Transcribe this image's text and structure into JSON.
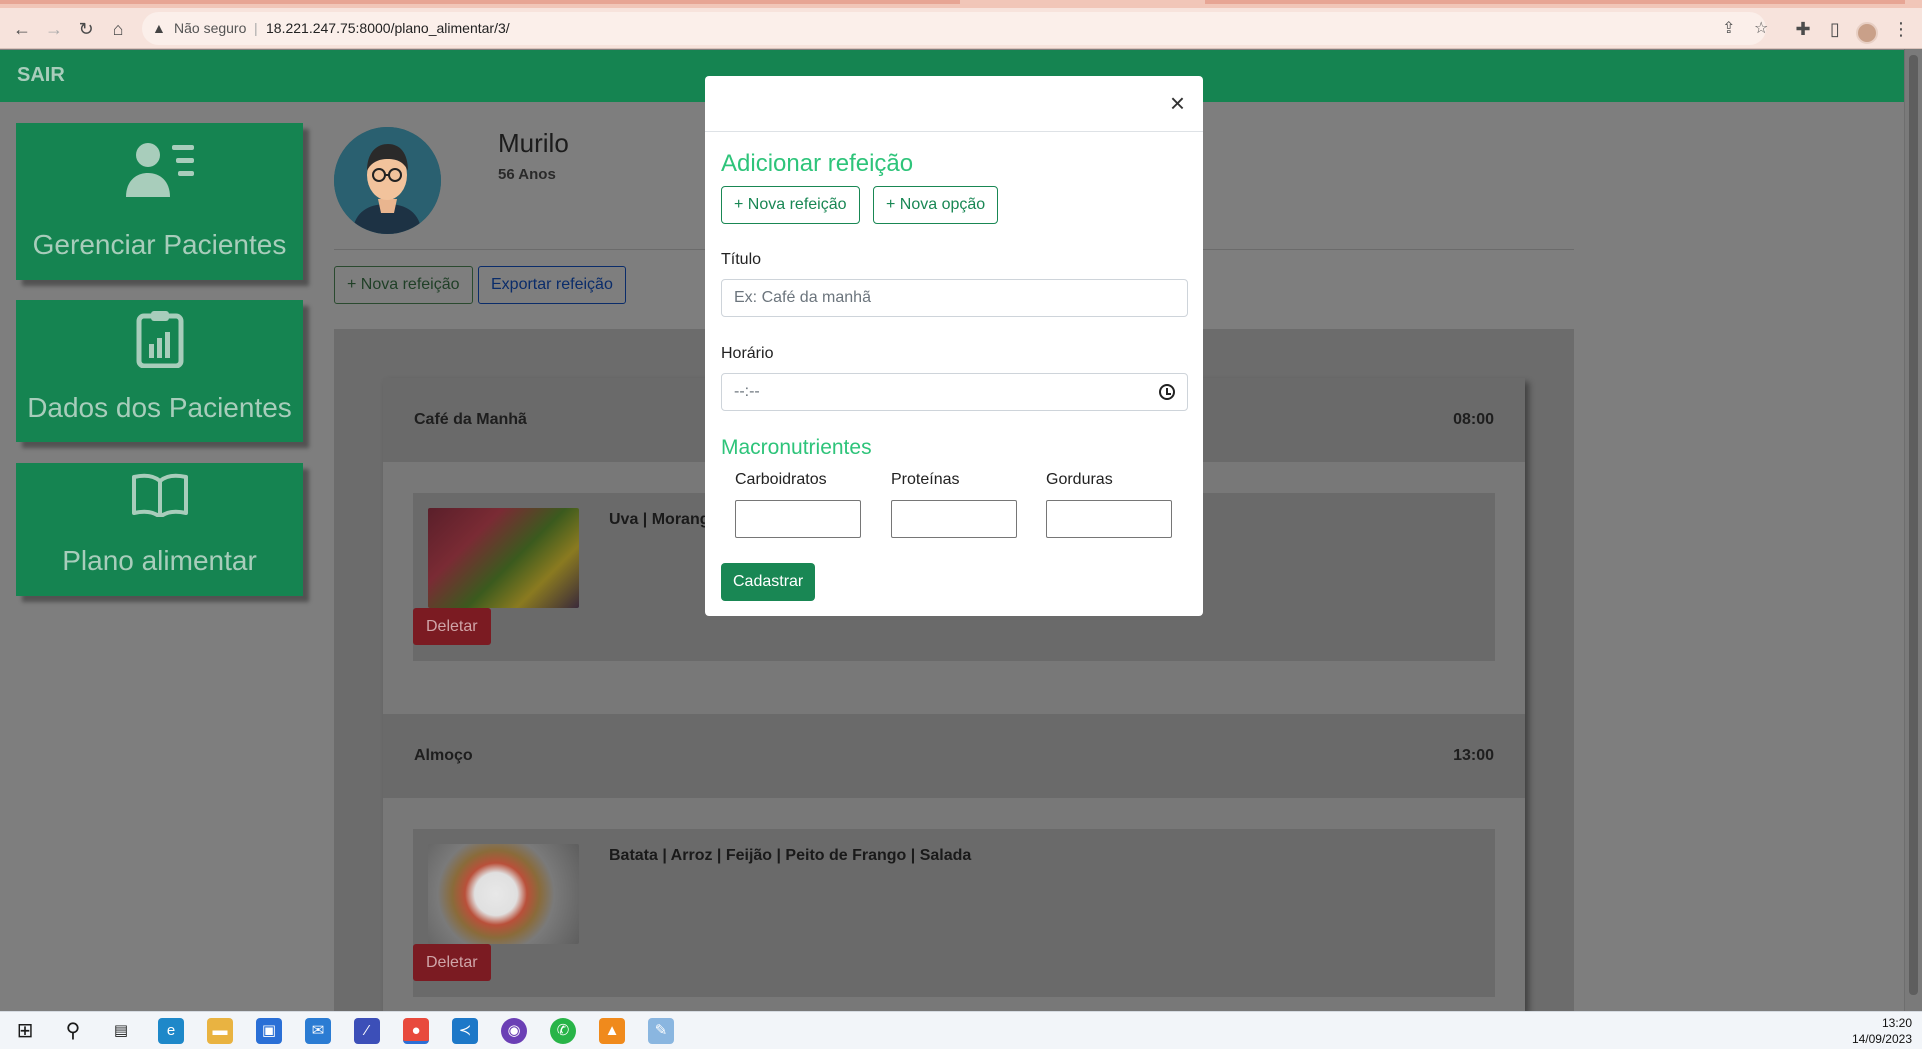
{
  "browser": {
    "security": "Não seguro",
    "url": "18.221.247.75:8000/plano_alimentar/3/"
  },
  "navbar": {
    "logout": "SAIR"
  },
  "sidebar": {
    "items": [
      {
        "label": "Gerenciar Pacientes",
        "icon": "user-list-icon"
      },
      {
        "label": "Dados dos Pacientes",
        "icon": "clipboard-chart-icon"
      },
      {
        "label": "Plano alimentar",
        "icon": "open-book-icon"
      }
    ]
  },
  "patient": {
    "name": "Murilo",
    "age": "56 Anos"
  },
  "actions": {
    "new_meal": "+ Nova refeição",
    "export_meal": "Exportar refeição"
  },
  "meals": [
    {
      "title": "Café da Manhã",
      "time": "08:00",
      "option": "Uva | Morang",
      "delete": "Deletar"
    },
    {
      "title": "Almoço",
      "time": "13:00",
      "option": "Batata | Arroz | Feijão | Peito de Frango | Salada",
      "delete": "Deletar"
    }
  ],
  "modal": {
    "close": "×",
    "title": "Adicionar refeição",
    "new_meal": "+ Nova refeição",
    "new_option": "+ Nova opção",
    "title_label": "Título",
    "title_placeholder": "Ex: Café da manhã",
    "time_label": "Horário",
    "time_placeholder": "--:--",
    "macro_heading": "Macronutrientes",
    "carbs_label": "Carboidratos",
    "protein_label": "Proteínas",
    "fat_label": "Gorduras",
    "submit": "Cadastrar"
  },
  "taskbar": {
    "time": "13:20",
    "date": "14/09/2023"
  },
  "colors": {
    "brand": "#198754",
    "accent": "#2ec47a",
    "danger": "#dc3545"
  }
}
